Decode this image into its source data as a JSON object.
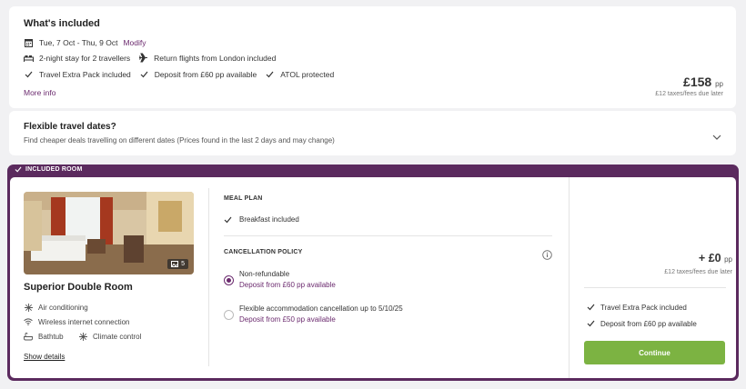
{
  "included": {
    "title": "What's included",
    "dates": "Tue, 7 Oct - Thu, 9 Oct",
    "modify": "Modify",
    "stay": "2-night stay for 2 travellers",
    "flights": "Return flights from London included",
    "features": [
      "Travel Extra Pack included",
      "Deposit from £60 pp available",
      "ATOL protected"
    ],
    "more_info": "More info",
    "price": "£158",
    "price_unit": "pp",
    "price_note": "£12 taxes/fees due later"
  },
  "flexible": {
    "title": "Flexible travel dates?",
    "subtitle": "Find cheaper deals travelling on different dates (Prices found in the last 2 days and may change)"
  },
  "room": {
    "tag": "INCLUDED ROOM",
    "photo_count": "5",
    "name": "Superior Double Room",
    "amenities": [
      "Air conditioning",
      "Wireless internet connection",
      "Bathtub",
      "Climate control"
    ],
    "show_details": "Show details",
    "meal_plan_title": "MEAL PLAN",
    "meal_plan": "Breakfast included",
    "cancellation_title": "CANCELLATION POLICY",
    "options": [
      {
        "label": "Non-refundable",
        "sub": "Deposit from £60 pp available",
        "selected": true
      },
      {
        "label": "Flexible accommodation cancellation up to 5/10/25",
        "sub": "Deposit from £50 pp available",
        "selected": false
      }
    ],
    "price": "+ £0",
    "price_unit": "pp",
    "price_note": "£12 taxes/fees due later",
    "perks": [
      "Travel Extra Pack included",
      "Deposit from £60 pp available"
    ],
    "continue": "Continue"
  },
  "colors": {
    "brand_purple": "#5b2a5e",
    "link_purple": "#6b2a6e",
    "continue_green": "#7cb342"
  }
}
